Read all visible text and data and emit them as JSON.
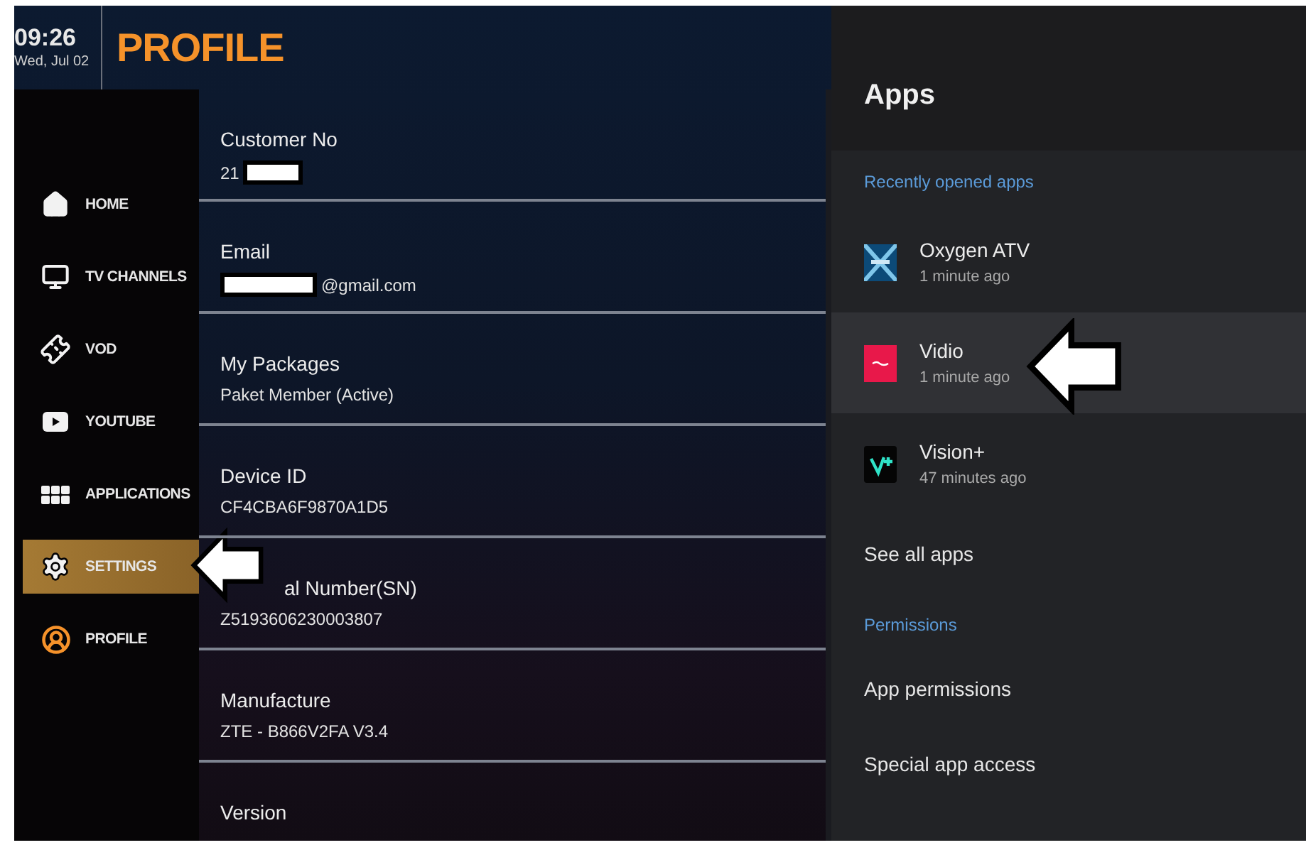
{
  "clock": {
    "time": "09:26",
    "date": "Wed, Jul 02"
  },
  "page_title": "PROFILE",
  "sidebar": {
    "items": [
      {
        "kind": "home",
        "label": "HOME",
        "selected": false,
        "current": false,
        "pointer_arrow": false
      },
      {
        "kind": "tv",
        "label": "TV CHANNELS",
        "selected": false,
        "current": false,
        "pointer_arrow": false
      },
      {
        "kind": "vod",
        "label": "VOD",
        "selected": false,
        "current": false,
        "pointer_arrow": false
      },
      {
        "kind": "youtube",
        "label": "YOUTUBE",
        "selected": false,
        "current": false,
        "pointer_arrow": false
      },
      {
        "kind": "apps",
        "label": "APPLICATIONS",
        "selected": false,
        "current": false,
        "pointer_arrow": false
      },
      {
        "kind": "settings",
        "label": "SETTINGS",
        "selected": true,
        "current": false,
        "pointer_arrow": true
      },
      {
        "kind": "profile",
        "label": "PROFILE",
        "selected": false,
        "current": true,
        "pointer_arrow": false
      }
    ]
  },
  "fields": [
    {
      "label": "Customer No",
      "value": "21",
      "masked_before": false,
      "masked_after": true,
      "obscured": false
    },
    {
      "label": "Email",
      "value": "@gmail.com",
      "masked_before": true,
      "masked_after": false,
      "obscured": false
    },
    {
      "label": "My Packages",
      "value": "Paket Member (Active)",
      "masked_before": false,
      "masked_after": false,
      "obscured": false
    },
    {
      "label": "Device ID",
      "value": "CF4CBA6F9870A1D5",
      "masked_before": false,
      "masked_after": false,
      "obscured": false
    },
    {
      "label": "al Number(SN)",
      "value": "Z5193606230003807",
      "masked_before": false,
      "masked_after": false,
      "obscured": true
    },
    {
      "label": "Manufacture",
      "value": "ZTE - B866V2FA V3.4",
      "masked_before": false,
      "masked_after": false,
      "obscured": false
    },
    {
      "label": "Version",
      "masked_before": false,
      "masked_after": false,
      "obscured": false
    }
  ],
  "apps_panel": {
    "title": "Apps",
    "recent_heading": "Recently opened apps",
    "recent_apps": [
      {
        "kind": "oxygen",
        "name": "Oxygen ATV",
        "time": "1 minute ago",
        "selected": false,
        "pointer_arrow": false
      },
      {
        "kind": "vidio",
        "name": "Vidio",
        "time": "1 minute ago",
        "selected": true,
        "pointer_arrow": true
      },
      {
        "kind": "vision",
        "name": "Vision+",
        "time": "47 minutes ago",
        "selected": false,
        "pointer_arrow": false
      }
    ],
    "see_all": "See all apps",
    "permissions_heading": "Permissions",
    "permission_items": [
      "App permissions",
      "Special app access"
    ]
  }
}
